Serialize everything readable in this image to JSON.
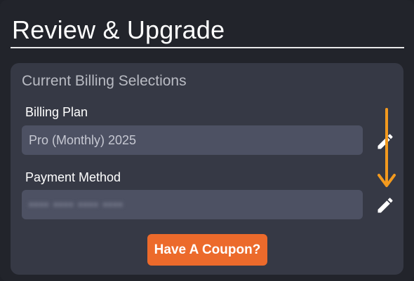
{
  "page": {
    "title": "Review & Upgrade"
  },
  "billing_card": {
    "heading": "Current Billing Selections",
    "billing_plan": {
      "label": "Billing Plan",
      "value": "Pro (Monthly) 2025",
      "edit_icon": "pencil-icon"
    },
    "payment_method": {
      "label": "Payment Method",
      "value": "•••• •••• •••• ••••",
      "value_obscured": true,
      "edit_icon": "pencil-icon"
    },
    "coupon_button": {
      "label": "Have A Coupon?"
    }
  },
  "annotation": {
    "icon": "arrow-down-icon",
    "color": "#f39a1e"
  },
  "colors": {
    "background": "#22242b",
    "card": "#363945",
    "field": "#4d5163",
    "accent": "#ec6a2b"
  }
}
